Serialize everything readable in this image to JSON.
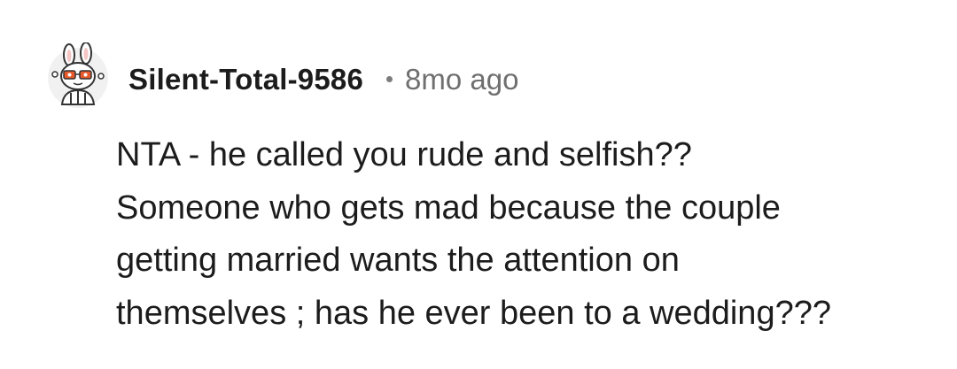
{
  "comment": {
    "author": "Silent-Total-9586",
    "separator": "•",
    "timestamp": "8mo ago",
    "avatar_icon": "snoo-bunny-avatar-icon",
    "body_lines": [
      "NTA - he called you rude and selfish??",
      "Someone who gets mad because the couple",
      "getting married wants the attention on",
      "themselves ; has he ever been to a wedding???"
    ]
  },
  "colors": {
    "background": "#ffffff",
    "text": "#1c1c1c",
    "meta": "#6f6f6f",
    "avatar_accent": "#e8592b"
  }
}
